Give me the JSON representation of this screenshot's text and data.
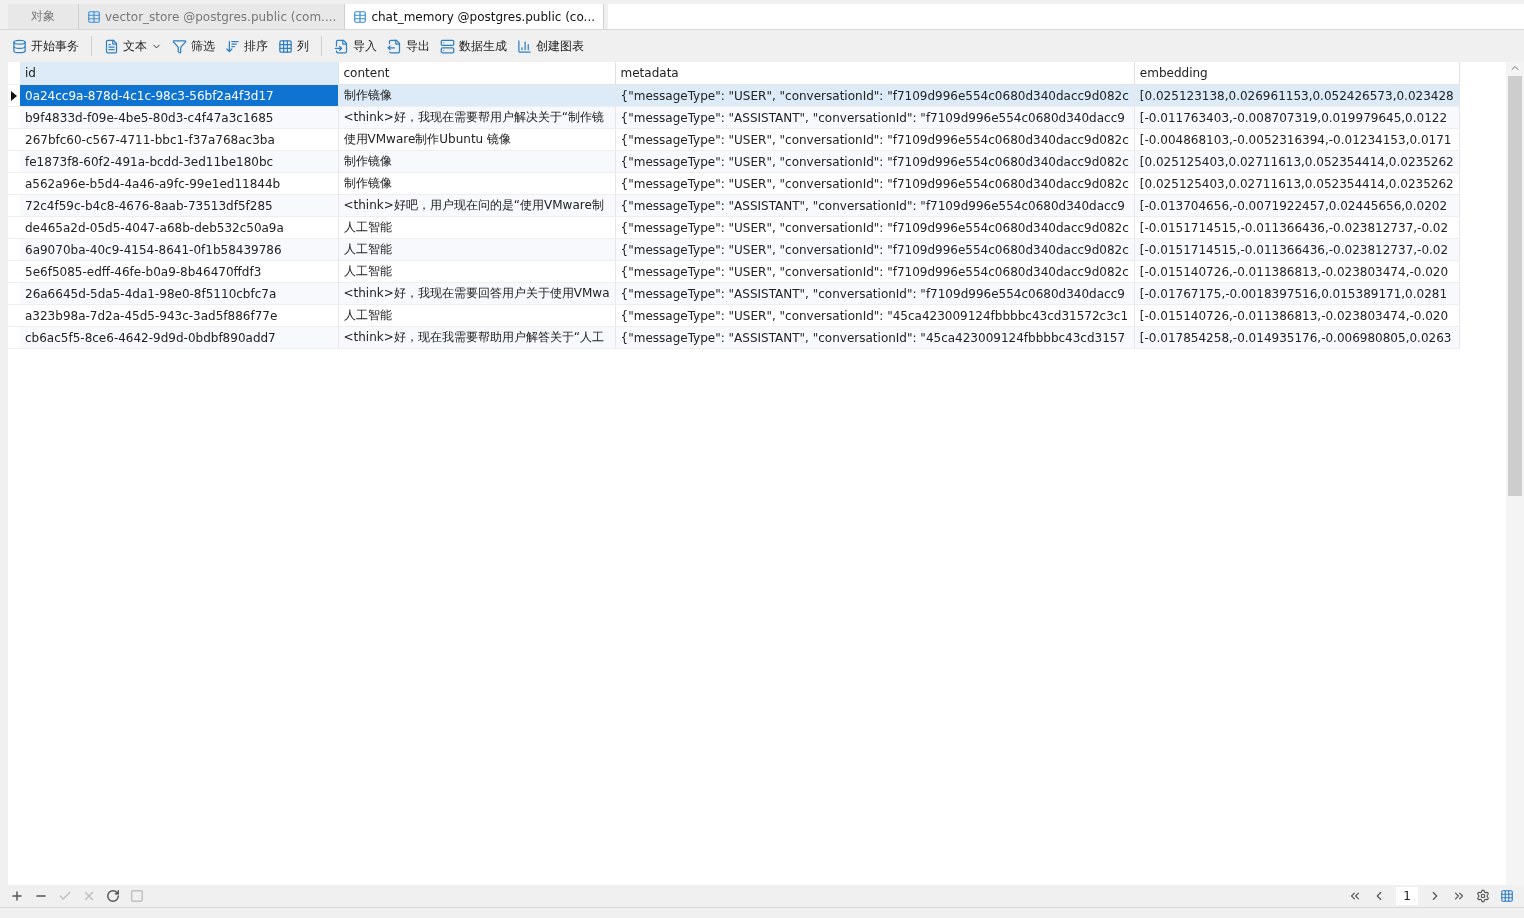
{
  "tabs": [
    {
      "label": "对象",
      "kind": "plain",
      "selected": false
    },
    {
      "label": "vector_store @postgres.public (com....",
      "kind": "table",
      "selected": false
    },
    {
      "label": "chat_memory @postgres.public (co...",
      "kind": "table",
      "selected": true
    }
  ],
  "toolbar": [
    {
      "buttons": [
        {
          "label": "开始事务",
          "kind": "transaction",
          "dropdown": false
        }
      ]
    },
    {
      "buttons": [
        {
          "label": "文本",
          "kind": "text",
          "dropdown": true
        },
        {
          "label": "筛选",
          "kind": "filter",
          "dropdown": false
        },
        {
          "label": "排序",
          "kind": "sort",
          "dropdown": false
        },
        {
          "label": "列",
          "kind": "columns",
          "dropdown": false
        }
      ]
    },
    {
      "buttons": [
        {
          "label": "导入",
          "kind": "import",
          "dropdown": false
        },
        {
          "label": "导出",
          "kind": "export",
          "dropdown": false
        },
        {
          "label": "数据生成",
          "kind": "generate",
          "dropdown": false
        },
        {
          "label": "创建图表",
          "kind": "chart",
          "dropdown": false
        }
      ]
    }
  ],
  "table": {
    "columns": [
      "id",
      "content",
      "metadata",
      "embedding"
    ],
    "rows": [
      {
        "selected": true,
        "cells": [
          "0a24cc9a-878d-4c1c-98c3-56bf2a4f3d17",
          "制作镜像",
          "{\"messageType\": \"USER\", \"conversationId\": \"f7109d996e554c0680d340dacc9d082c",
          "[0.025123138,0.026961153,0.052426573,0.023428"
        ]
      },
      {
        "selected": false,
        "cells": [
          "b9f4833d-f09e-4be5-80d3-c4f47a3c1685",
          "<think>好，我现在需要帮用户解决关于“制作镜",
          "{\"messageType\": \"ASSISTANT\", \"conversationId\": \"f7109d996e554c0680d340dacc9",
          "[-0.011763403,-0.008707319,0.019979645,0.0122"
        ]
      },
      {
        "selected": false,
        "cells": [
          "267bfc60-c567-4711-bbc1-f37a768ac3ba",
          "使用VMware制作Ubuntu 镜像",
          "{\"messageType\": \"USER\", \"conversationId\": \"f7109d996e554c0680d340dacc9d082c",
          "[-0.004868103,-0.0052316394,-0.01234153,0.0171"
        ]
      },
      {
        "selected": false,
        "cells": [
          "fe1873f8-60f2-491a-bcdd-3ed11be180bc",
          "制作镜像",
          "{\"messageType\": \"USER\", \"conversationId\": \"f7109d996e554c0680d340dacc9d082c",
          "[0.025125403,0.02711613,0.052354414,0.0235262"
        ]
      },
      {
        "selected": false,
        "cells": [
          "a562a96e-b5d4-4a46-a9fc-99e1ed11844b",
          "制作镜像",
          "{\"messageType\": \"USER\", \"conversationId\": \"f7109d996e554c0680d340dacc9d082c",
          "[0.025125403,0.02711613,0.052354414,0.0235262"
        ]
      },
      {
        "selected": false,
        "cells": [
          "72c4f59c-b4c8-4676-8aab-73513df5f285",
          "<think>好吧，用户现在问的是“使用VMware制",
          "{\"messageType\": \"ASSISTANT\", \"conversationId\": \"f7109d996e554c0680d340dacc9",
          "[-0.013704656,-0.0071922457,0.02445656,0.0202"
        ]
      },
      {
        "selected": false,
        "cells": [
          "de465a2d-05d5-4047-a68b-deb532c50a9a",
          "人工智能",
          "{\"messageType\": \"USER\", \"conversationId\": \"f7109d996e554c0680d340dacc9d082c",
          "[-0.0151714515,-0.011366436,-0.023812737,-0.02"
        ]
      },
      {
        "selected": false,
        "cells": [
          "6a9070ba-40c9-4154-8641-0f1b58439786",
          "人工智能",
          "{\"messageType\": \"USER\", \"conversationId\": \"f7109d996e554c0680d340dacc9d082c",
          "[-0.0151714515,-0.011366436,-0.023812737,-0.02"
        ]
      },
      {
        "selected": false,
        "cells": [
          "5e6f5085-edff-46fe-b0a9-8b46470ffdf3",
          "人工智能",
          "{\"messageType\": \"USER\", \"conversationId\": \"f7109d996e554c0680d340dacc9d082c",
          "[-0.015140726,-0.011386813,-0.023803474,-0.020"
        ]
      },
      {
        "selected": false,
        "cells": [
          "26a6645d-5da5-4da1-98e0-8f5110cbfc7a",
          "<think>好，我现在需要回答用户关于使用VMwa",
          "{\"messageType\": \"ASSISTANT\", \"conversationId\": \"f7109d996e554c0680d340dacc9",
          "[-0.01767175,-0.0018397516,0.015389171,0.0281"
        ]
      },
      {
        "selected": false,
        "cells": [
          "a323b98a-7d2a-45d5-943c-3ad5f886f77e",
          "人工智能",
          "{\"messageType\": \"USER\", \"conversationId\": \"45ca423009124fbbbbc43cd31572c3c1",
          "[-0.015140726,-0.011386813,-0.023803474,-0.020"
        ]
      },
      {
        "selected": false,
        "cells": [
          "cb6ac5f5-8ce6-4642-9d9d-0bdbf890add7",
          "<think>好，现在我需要帮助用户解答关于“人工",
          "{\"messageType\": \"ASSISTANT\", \"conversationId\": \"45ca423009124fbbbbc43cd3157",
          "[-0.017854258,-0.014935176,-0.006980805,0.0263"
        ]
      }
    ]
  },
  "bottom_bar": {
    "actions": [
      {
        "kind": "add",
        "disabled": false
      },
      {
        "kind": "remove",
        "disabled": false
      },
      {
        "kind": "apply",
        "disabled": true
      },
      {
        "kind": "cancel",
        "disabled": true
      },
      {
        "kind": "refresh",
        "disabled": false
      },
      {
        "kind": "stop",
        "disabled": true
      }
    ],
    "page": "1"
  }
}
